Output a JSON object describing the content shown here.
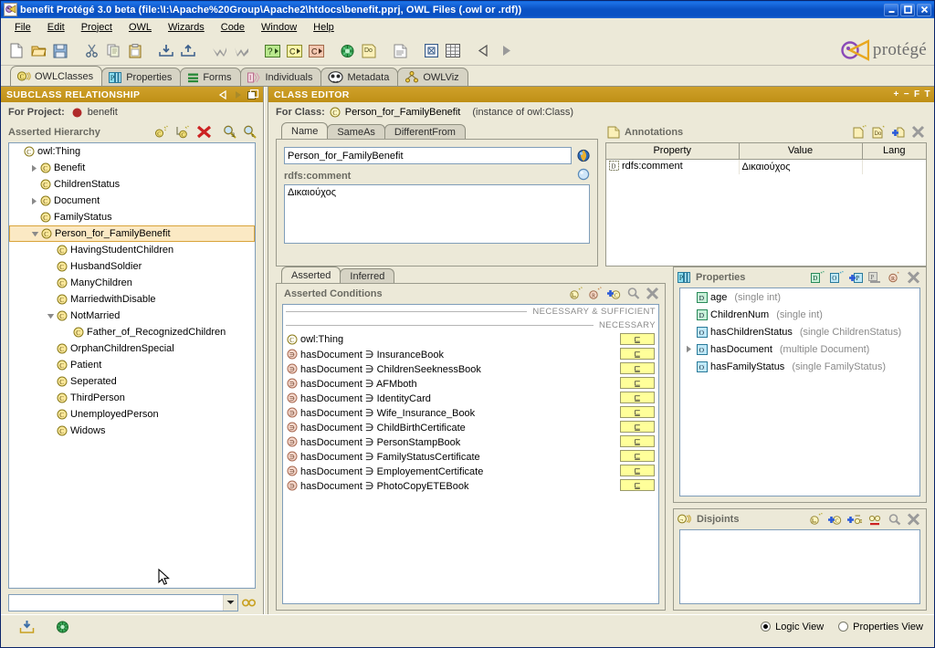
{
  "window": {
    "title": "benefit  Protégé 3.0 beta   (file:\\I:\\Apache%20Group\\Apache2\\htdocs\\benefit.pprj, OWL Files (.owl or .rdf))",
    "app_icon": "protege-icon",
    "minimize_label": "_",
    "maximize_label": "□",
    "close_label": "✕"
  },
  "menubar": {
    "items": [
      {
        "label": "File",
        "mnemonic": "F"
      },
      {
        "label": "Edit",
        "mnemonic": "E"
      },
      {
        "label": "Project",
        "mnemonic": "P"
      },
      {
        "label": "OWL",
        "mnemonic": "O"
      },
      {
        "label": "Wizards",
        "mnemonic": "W"
      },
      {
        "label": "Code",
        "mnemonic": "C"
      },
      {
        "label": "Window",
        "mnemonic": "W"
      },
      {
        "label": "Help",
        "mnemonic": "H"
      }
    ]
  },
  "toolbar": {
    "buttons": [
      {
        "name": "new-project-icon",
        "tip": "New Project"
      },
      {
        "name": "open-project-icon",
        "tip": "Open Project"
      },
      {
        "name": "save-project-icon",
        "tip": "Save Project"
      },
      {
        "name": "cut-icon",
        "tip": "Cut"
      },
      {
        "name": "copy-icon",
        "tip": "Copy"
      },
      {
        "name": "paste-icon",
        "tip": "Paste"
      },
      {
        "name": "import-icon",
        "tip": "Import"
      },
      {
        "name": "export-icon",
        "tip": "Export"
      },
      {
        "name": "undo-icon",
        "tip": "Undo"
      },
      {
        "name": "redo-icon",
        "tip": "Redo"
      },
      {
        "name": "query-icon",
        "tip": "Queries"
      },
      {
        "name": "create-class-icon",
        "tip": "Create Class"
      },
      {
        "name": "create-subclass-icon",
        "tip": "Create Subclass"
      },
      {
        "name": "ontoviz-icon",
        "tip": "OntoViz"
      },
      {
        "name": "documentation-icon",
        "tip": "Documentation"
      },
      {
        "name": "notes-icon",
        "tip": "Notes"
      },
      {
        "name": "form-icon",
        "tip": "Form"
      },
      {
        "name": "table-icon",
        "tip": "Table"
      },
      {
        "name": "back-icon",
        "tip": "Back"
      },
      {
        "name": "forward-icon",
        "tip": "Forward"
      }
    ],
    "brand": "protégé"
  },
  "tabs": [
    {
      "label": "OWLClasses",
      "icon": "owl-class-icon",
      "active": true
    },
    {
      "label": "Properties",
      "icon": "properties-icon",
      "active": false
    },
    {
      "label": "Forms",
      "icon": "forms-icon",
      "active": false
    },
    {
      "label": "Individuals",
      "icon": "individuals-icon",
      "active": false
    },
    {
      "label": "Metadata",
      "icon": "metadata-icon",
      "active": false
    },
    {
      "label": "OWLViz",
      "icon": "owlviz-icon",
      "active": false
    }
  ],
  "subclass_panel": {
    "header": "SUBCLASS RELATIONSHIP",
    "header_tools": [
      "back-icon",
      "forward-icon",
      "detach-icon"
    ],
    "for_project_label": "For Project:",
    "project_name": "benefit",
    "hierarchy_label": "Asserted Hierarchy",
    "hierarchy_tools": [
      "create-class-icon",
      "create-subclass-icon",
      "delete-class-icon",
      "search-exists-icon",
      "search-class-icon"
    ],
    "tree": [
      {
        "label": "owl:Thing",
        "depth": 0,
        "twisty": "none",
        "selected": false,
        "root": true
      },
      {
        "label": "Benefit",
        "depth": 1,
        "twisty": "collapsed",
        "selected": false
      },
      {
        "label": "ChildrenStatus",
        "depth": 1,
        "twisty": "none",
        "selected": false
      },
      {
        "label": "Document",
        "depth": 1,
        "twisty": "collapsed",
        "selected": false
      },
      {
        "label": "FamilyStatus",
        "depth": 1,
        "twisty": "none",
        "selected": false
      },
      {
        "label": "Person_for_FamilyBenefit",
        "depth": 1,
        "twisty": "expanded",
        "selected": true
      },
      {
        "label": "HavingStudentChildren",
        "depth": 2,
        "twisty": "none",
        "selected": false
      },
      {
        "label": "HusbandSoldier",
        "depth": 2,
        "twisty": "none",
        "selected": false
      },
      {
        "label": "ManyChildren",
        "depth": 2,
        "twisty": "none",
        "selected": false
      },
      {
        "label": "MarriedwithDisable",
        "depth": 2,
        "twisty": "none",
        "selected": false
      },
      {
        "label": "NotMarried",
        "depth": 2,
        "twisty": "expanded",
        "selected": false
      },
      {
        "label": "Father_of_RecognizedChildren",
        "depth": 3,
        "twisty": "none",
        "selected": false
      },
      {
        "label": "OrphanChildrenSpecial",
        "depth": 2,
        "twisty": "none",
        "selected": false
      },
      {
        "label": "Patient",
        "depth": 2,
        "twisty": "none",
        "selected": false
      },
      {
        "label": "Seperated",
        "depth": 2,
        "twisty": "none",
        "selected": false
      },
      {
        "label": "ThirdPerson",
        "depth": 2,
        "twisty": "none",
        "selected": false
      },
      {
        "label": "UnemployedPerson",
        "depth": 2,
        "twisty": "none",
        "selected": false
      },
      {
        "label": "Widows",
        "depth": 2,
        "twisty": "none",
        "selected": false
      }
    ],
    "search": {
      "value": "",
      "placeholder": ""
    },
    "search_icon": "find-icon"
  },
  "class_editor": {
    "header": "CLASS EDITOR",
    "header_tools": [
      "+",
      "−",
      "F",
      "T"
    ],
    "for_class_label": "For Class:",
    "class_name": "Person_for_FamilyBenefit",
    "class_instance_of": "(instance of owl:Class)",
    "tabs": [
      {
        "label": "Name",
        "active": true
      },
      {
        "label": "SameAs",
        "active": false
      },
      {
        "label": "DifferentFrom",
        "active": false
      }
    ],
    "name_field": {
      "value": "Person_for_FamilyBenefit",
      "placeholder": ""
    },
    "name_field_icon": "owl-globe-icon",
    "comment_label": "rdfs:comment",
    "comment_icon": "language-circle-icon",
    "comment_value": "Δικαιούχος"
  },
  "annotations": {
    "title": "Annotations",
    "title_icon": "annotations-icon",
    "tools": [
      "create-annotation-icon",
      "create-datatype-annotation-icon",
      "add-annotation-icon",
      "remove-annotation-icon"
    ],
    "columns": [
      "Property",
      "Value",
      "Lang"
    ],
    "rows": [
      {
        "icon": "datatype-property-icon",
        "property": "rdfs:comment",
        "value": "Δικαιούχος",
        "lang": ""
      }
    ]
  },
  "conditions": {
    "tabs": [
      {
        "label": "Asserted",
        "active": true
      },
      {
        "label": "Inferred",
        "active": false
      }
    ],
    "title": "Asserted Conditions",
    "tools": [
      "create-restriction-icon",
      "create-relation-icon",
      "add-named-class-icon",
      "view-icon",
      "delete-icon"
    ],
    "groups": [
      {
        "label": "NECESSARY & SUFFICIENT",
        "items": []
      },
      {
        "label": "NECESSARY",
        "items": [
          {
            "icon": "class-icon",
            "text": "owl:Thing",
            "badge": "⊑"
          },
          {
            "icon": "restriction-icon",
            "text": "hasDocument ∋ InsuranceBook",
            "badge": "⊑"
          },
          {
            "icon": "restriction-icon",
            "text": "hasDocument ∋ ChildrenSeeknessBook",
            "badge": "⊑"
          },
          {
            "icon": "restriction-icon",
            "text": "hasDocument ∋ AFMboth",
            "badge": "⊑"
          },
          {
            "icon": "restriction-icon",
            "text": "hasDocument ∋ IdentityCard",
            "badge": "⊑"
          },
          {
            "icon": "restriction-icon",
            "text": "hasDocument ∋ Wife_Insurance_Book",
            "badge": "⊑"
          },
          {
            "icon": "restriction-icon",
            "text": "hasDocument ∋ ChildBirthCertificate",
            "badge": "⊑"
          },
          {
            "icon": "restriction-icon",
            "text": "hasDocument ∋ PersonStampBook",
            "badge": "⊑"
          },
          {
            "icon": "restriction-icon",
            "text": "hasDocument ∋ FamilyStatusCertificate",
            "badge": "⊑"
          },
          {
            "icon": "restriction-icon",
            "text": "hasDocument ∋ EmployementCertificate",
            "badge": "⊑"
          },
          {
            "icon": "restriction-icon",
            "text": "hasDocument ∋ PhotoCopyETEBook",
            "badge": "⊑"
          }
        ]
      }
    ]
  },
  "properties_panel": {
    "title": "Properties",
    "title_icon": "properties-icon",
    "tools": [
      "create-datatype-property-icon",
      "create-object-property-icon",
      "add-property-icon",
      "property-widget-icon",
      "relation-icon",
      "remove-property-icon"
    ],
    "rows": [
      {
        "kind": "D",
        "name": "age",
        "type": "(single int)",
        "twisty": "none"
      },
      {
        "kind": "D",
        "name": "ChildrenNum",
        "type": "(single int)",
        "twisty": "none"
      },
      {
        "kind": "O",
        "name": "hasChildrenStatus",
        "type": "(single ChildrenStatus)",
        "twisty": "none"
      },
      {
        "kind": "O",
        "name": "hasDocument",
        "type": "(multiple Document)",
        "twisty": "collapsed"
      },
      {
        "kind": "O",
        "name": "hasFamilyStatus",
        "type": "(single FamilyStatus)",
        "twisty": "none"
      }
    ]
  },
  "disjoints_panel": {
    "title": "Disjoints",
    "title_icon": "disjoints-icon",
    "tools": [
      "create-disjoint-icon",
      "add-disjoint-class-icon",
      "add-all-disjoints-icon",
      "remove-all-disjoints-icon",
      "view-disjoint-icon",
      "delete-disjoint-icon"
    ],
    "rows": []
  },
  "statusbar": {
    "left_icons": [
      "import-status-icon",
      "reasoner-status-icon"
    ],
    "views": [
      {
        "label": "Logic View",
        "selected": true
      },
      {
        "label": "Properties View",
        "selected": false
      }
    ]
  },
  "colors": {
    "title_bar": "#0a52c4",
    "panel_header": "#c89b21",
    "app_background": "#ece9d8",
    "selection": "#fbe9c4",
    "selection_border": "#d9a43a",
    "badge_yellow": "#ffff9a"
  }
}
